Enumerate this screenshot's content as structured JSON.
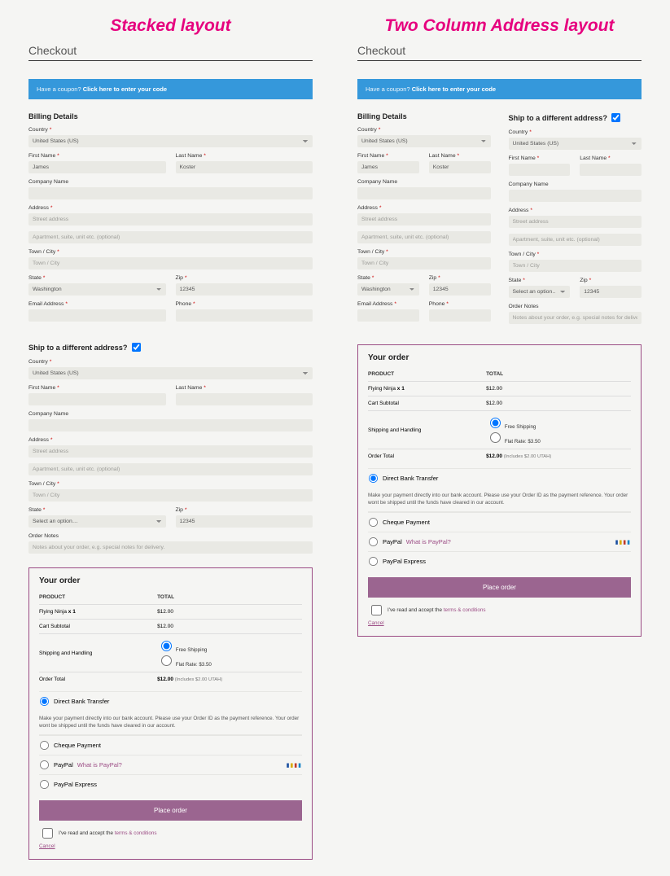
{
  "layouts": {
    "stacked_title": "Stacked layout",
    "twocol_title": "Two Column Address layout"
  },
  "page_title": "Checkout",
  "coupon": {
    "prompt": "Have a coupon? ",
    "link": "Click here to enter your code"
  },
  "labels": {
    "billing_details": "Billing Details",
    "ship_different": "Ship to a different address?",
    "country": "Country",
    "first_name": "First Name",
    "last_name": "Last Name",
    "company": "Company Name",
    "address": "Address",
    "town": "Town / City",
    "state": "State",
    "zip": "Zip",
    "email": "Email Address",
    "phone": "Phone",
    "order_notes": "Order Notes"
  },
  "placeholders": {
    "street": "Street address",
    "apt": "Apartment, suite, unit etc. (optional)",
    "town": "Town / City",
    "notes": "Notes about your order, e.g. special notes for delivery."
  },
  "values": {
    "country": "United States (US)",
    "first_name": "James",
    "last_name": "Koster",
    "state_billing": "Washington",
    "state_ship_placeholder": "Select an option…",
    "zip": "12345"
  },
  "order": {
    "heading": "Your order",
    "th_product": "PRODUCT",
    "th_total": "TOTAL",
    "item_name": "Flying Ninja",
    "item_qty": "x 1",
    "item_total": "$12.00",
    "sub_label": "Cart Subtotal",
    "sub_value": "$12.00",
    "ship_label": "Shipping and Handling",
    "ship_free": "Free Shipping",
    "ship_flat": "Flat Rate: $3.50",
    "order_total_label": "Order Total",
    "order_total_value": "$12.00",
    "order_total_note": "(Includes $2.00 UTAH)"
  },
  "payments": {
    "direct": "Direct Bank Transfer",
    "direct_desc": "Make your payment directly into our bank account. Please use your Order ID as the payment reference. Your order wont be shipped until the funds have cleared in our account.",
    "cheque": "Cheque Payment",
    "paypal": "PayPal",
    "paypal_q": "What is PayPal?",
    "paypal_express": "PayPal Express"
  },
  "actions": {
    "place_order": "Place order",
    "terms_pre": "I've read and accept the ",
    "terms_link": "terms & conditions",
    "cancel": "Cancel"
  }
}
